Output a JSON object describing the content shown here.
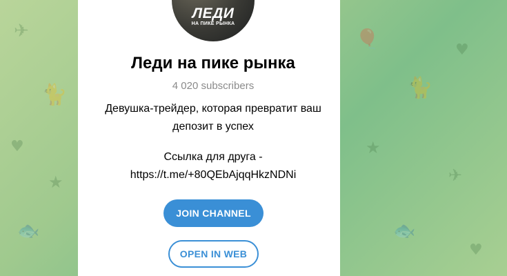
{
  "channel": {
    "avatar_logo_line1": "ЛЕДИ",
    "avatar_logo_line2": "НА ПИКЕ РЫНКА",
    "title": "Леди на пике рынка",
    "subscribers": "4 020 subscribers",
    "description_line1": "Девушка-трейдер, которая превратит ваш",
    "description_line2": "депозит в успех",
    "description_line3": "Ссылка для друга -",
    "description_line4": "https://t.me/+80QEbAjqqHkzNDNi"
  },
  "buttons": {
    "join_label": "JOIN CHANNEL",
    "web_label": "OPEN IN WEB"
  },
  "colors": {
    "accent": "#3a8fd6",
    "background_green": "#9fc98e"
  },
  "icons": [
    "paper-plane-icon",
    "cat-icon",
    "fish-icon",
    "heart-icon",
    "star-icon",
    "balloon-icon"
  ]
}
